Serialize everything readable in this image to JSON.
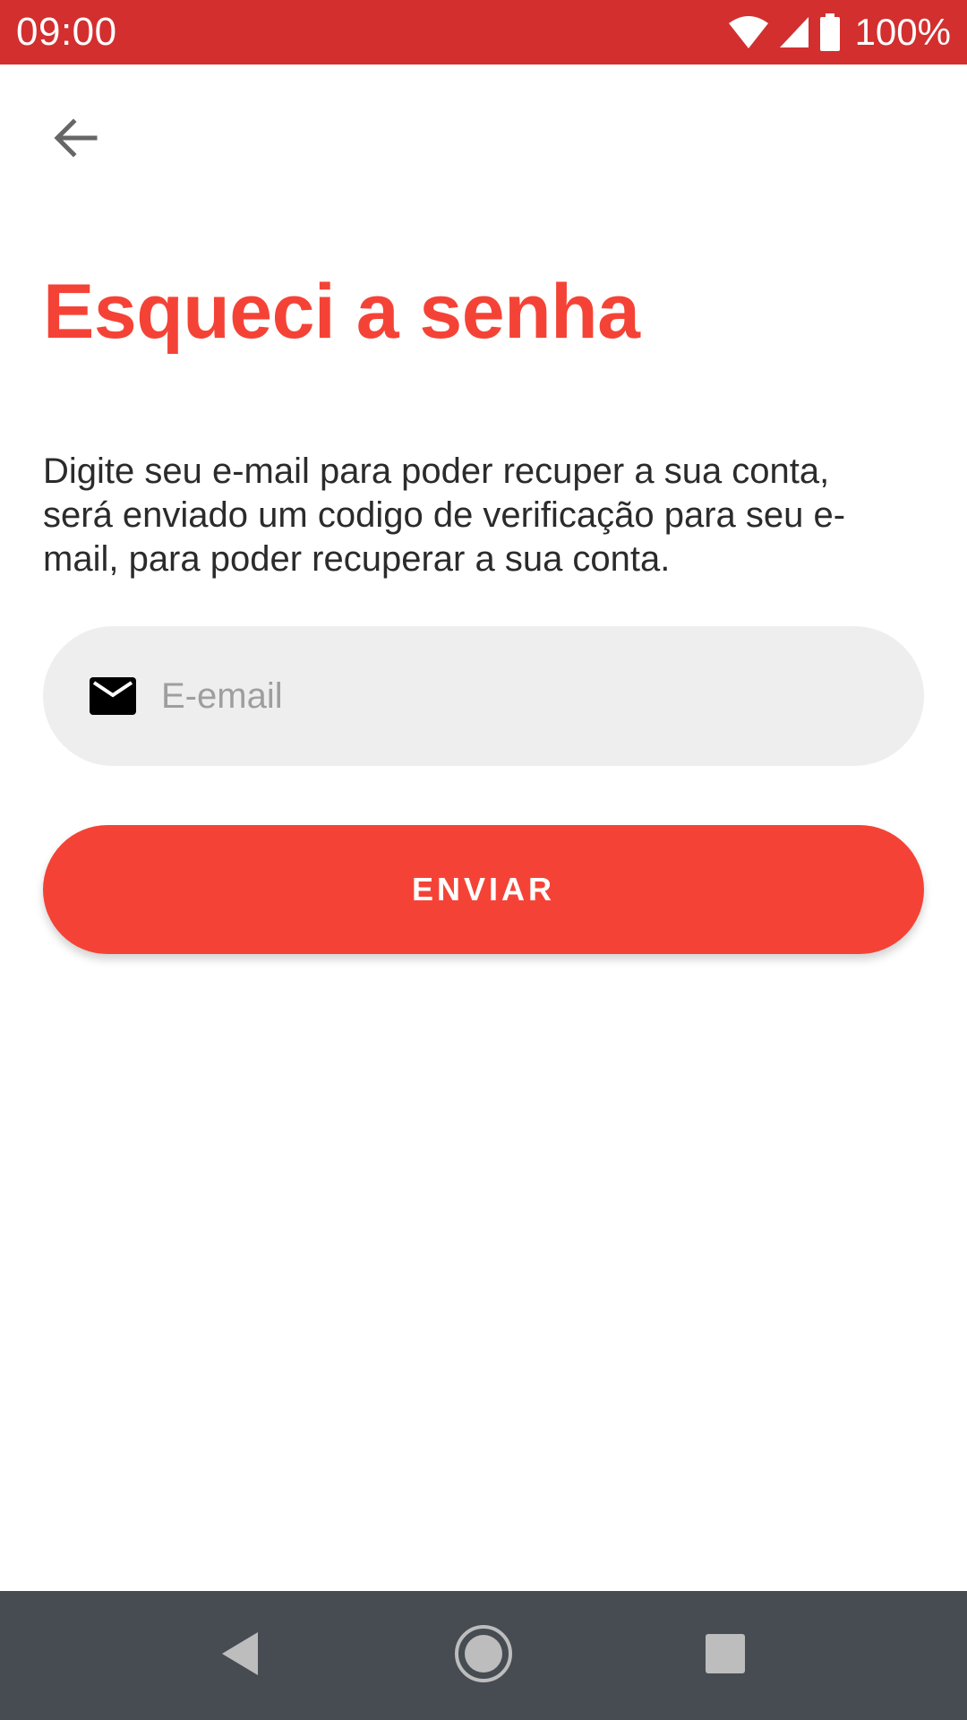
{
  "status_bar": {
    "time": "09:00",
    "battery": "100%",
    "background": "#d32f2f",
    "icons": [
      "wifi-icon",
      "cell-signal-icon",
      "battery-icon"
    ]
  },
  "toolbar": {
    "back_icon": "arrow-back-icon"
  },
  "page": {
    "title": "Esqueci a senha",
    "title_color": "#f44336",
    "description": "Digite seu e-mail para poder recuper a sua conta, será enviado um codigo de verificação para seu e-mail, para poder recuperar a sua conta."
  },
  "form": {
    "email": {
      "icon": "mail-icon",
      "placeholder": "E-email",
      "value": ""
    },
    "submit_label": "ENVIAR",
    "accent": "#f44336"
  },
  "nav_bar": {
    "buttons": [
      "back-triangle-icon",
      "home-circle-icon",
      "recents-square-icon"
    ]
  }
}
